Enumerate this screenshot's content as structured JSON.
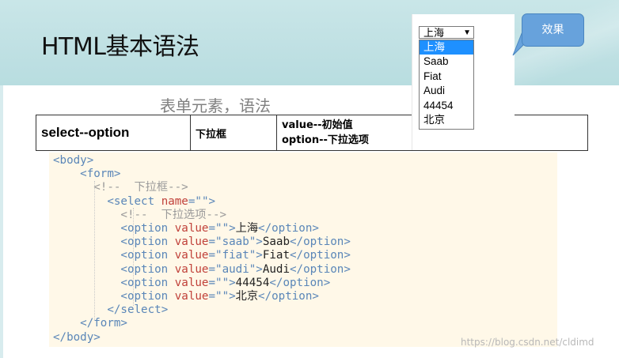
{
  "slide": {
    "title": "HTML基本语法",
    "subtitle": "表单元素，语法"
  },
  "syntax_table": {
    "element": "select--option",
    "meaning": "下拉框",
    "notes_line1": "value--初始值",
    "notes_line2": "option--下拉选项"
  },
  "code": {
    "lines": [
      "<body>",
      "<form>",
      "<!--  下拉框-->",
      "<select name=\"\">",
      "<!--  下拉选项-->",
      "<option value=\"\">上海</option>",
      "<option value=\"saab\">Saab</option>",
      "<option value=\"fiat\">Fiat</option>",
      "<option value=\"audi\">Audi</option>",
      "<option value=\"\">44454</option>",
      "<option value=\"\">北京</option>",
      "</select>",
      "</form>",
      "</body>"
    ]
  },
  "preview": {
    "selected_value": "上海",
    "options": [
      "上海",
      "Saab",
      "Fiat",
      "Audi",
      "44454",
      "北京"
    ],
    "highlight_color": "#1e90ff",
    "callout_label": "效果"
  },
  "watermark": "https://blog.csdn.net/cldimd",
  "colors": {
    "header": "#c9e6e8",
    "code_bg": "#fff8e8",
    "tag": "#5a86b8",
    "attr": "#c0413a",
    "callout": "#67a2dc"
  }
}
